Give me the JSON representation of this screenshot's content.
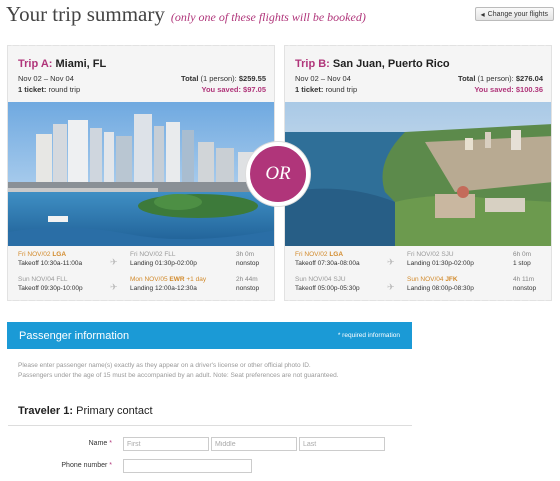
{
  "header": {
    "title": "Your trip summary",
    "subtitle": "(only one of these flights will be booked)",
    "change_button": "Change your flights",
    "change_icon": "left-arrow-icon"
  },
  "trips": [
    {
      "label": "Trip A:",
      "destination": "Miami, FL",
      "dates": "Nov 02 – Nov 04",
      "total_label": "Total",
      "total_people": "(1 person):",
      "total": "$259.55",
      "tickets": "1 ticket:",
      "ticket_type": "round trip",
      "saved_text": "You saved: $97.05",
      "outbound": {
        "dep_date": "Fri NOV/02",
        "dep_code": "LGA",
        "dep_time": "Takeoff 10:30a-11:00a",
        "arr_date": "Fri NOV/02",
        "arr_code": "FLL",
        "arr_extra": "",
        "arr_time": "Landing 01:30p-02:00p",
        "duration": "3h 0m",
        "stops": "nonstop"
      },
      "return": {
        "dep_date": "Sun NOV/04",
        "dep_code": "FLL",
        "dep_time": "Takeoff 09:30p-10:00p",
        "arr_date": "Mon NOV/05",
        "arr_code": "EWR",
        "arr_extra": "+1 day",
        "arr_time": "Landing 12:00a-12:30a",
        "duration": "2h 44m",
        "stops": "nonstop"
      }
    },
    {
      "label": "Trip B:",
      "destination": "San Juan, Puerto Rico",
      "dates": "Nov 02 – Nov 04",
      "total_label": "Total",
      "total_people": "(1 person):",
      "total": "$276.04",
      "tickets": "1 ticket:",
      "ticket_type": "round trip",
      "saved_text": "You saved: $100.36",
      "outbound": {
        "dep_date": "Fri NOV/02",
        "dep_code": "LGA",
        "dep_time": "Takeoff 07:30a-08:00a",
        "arr_date": "Fri NOV/02",
        "arr_code": "SJU",
        "arr_extra": "",
        "arr_time": "Landing 01:30p-02:00p",
        "duration": "6h 0m",
        "stops": "1 stop"
      },
      "return": {
        "dep_date": "Sun NOV/04",
        "dep_code": "SJU",
        "dep_time": "Takeoff 05:00p-05:30p",
        "arr_date": "Sun NOV/04",
        "arr_code": "JFK",
        "arr_extra": "",
        "arr_time": "Landing 08:00p-08:30p",
        "duration": "4h 11m",
        "stops": "nonstop"
      }
    }
  ],
  "or_label": "OR",
  "passenger": {
    "title": "Passenger information",
    "required": "* required information",
    "note_line1": "Please enter passenger name(s) exactly as they appear on a driver's license or other official photo ID.",
    "note_line2": "Passengers under the age of 15 must be accompanied by an adult. Note: Seat preferences are not guaranteed.",
    "traveler_label": "Traveler 1:",
    "traveler_role": "Primary contact",
    "name_label": "Name",
    "phone_label": "Phone number",
    "required_star": "*",
    "first_placeholder": "First",
    "middle_placeholder": "Middle",
    "last_placeholder": "Last",
    "phone_placeholder": ""
  },
  "colors": {
    "accent": "#b0357a",
    "bar_blue": "#1b9ad6",
    "date_orange": "#d28a2b"
  }
}
